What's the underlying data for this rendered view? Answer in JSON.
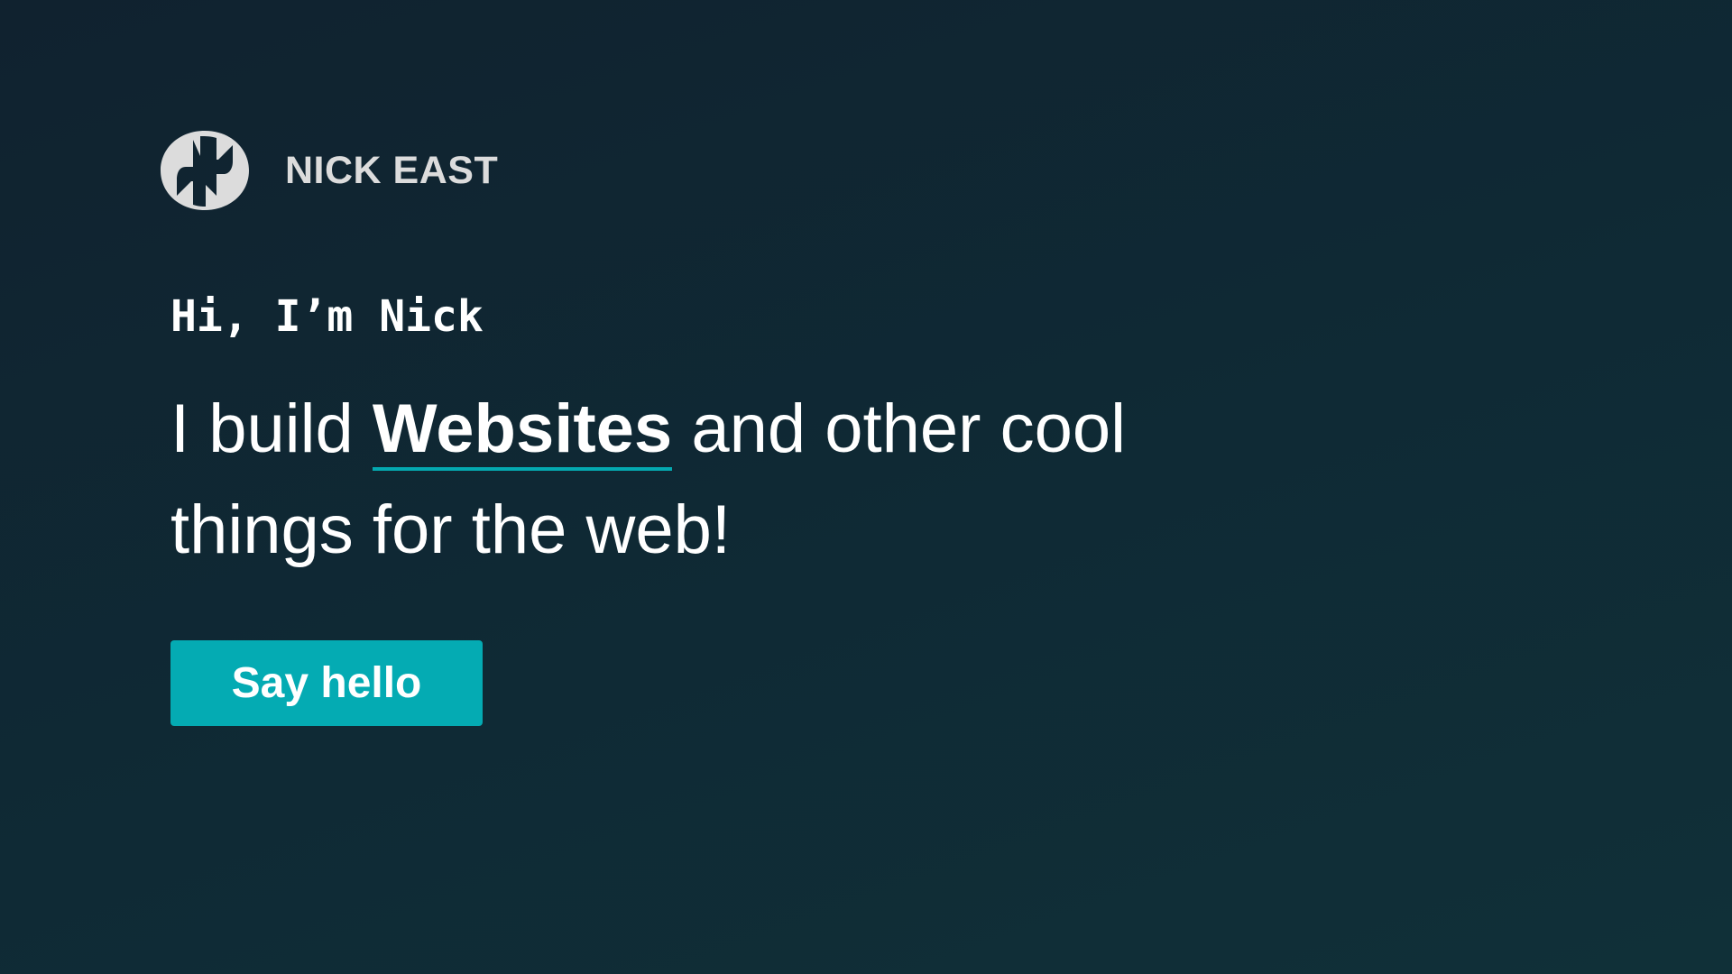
{
  "brand": {
    "name": "NICK EAST",
    "logo_icon": "nick-east-logo-icon",
    "logo_color": "#dcdcdc"
  },
  "hero": {
    "greeting": "Hi, I’m Nick",
    "headline_before": "I build ",
    "headline_highlight": "Websites",
    "headline_after": " and other cool things for the web!",
    "cta_label": "Say hello"
  },
  "colors": {
    "background": "#10262f",
    "accent": "#04abb3",
    "text": "#ffffff"
  }
}
